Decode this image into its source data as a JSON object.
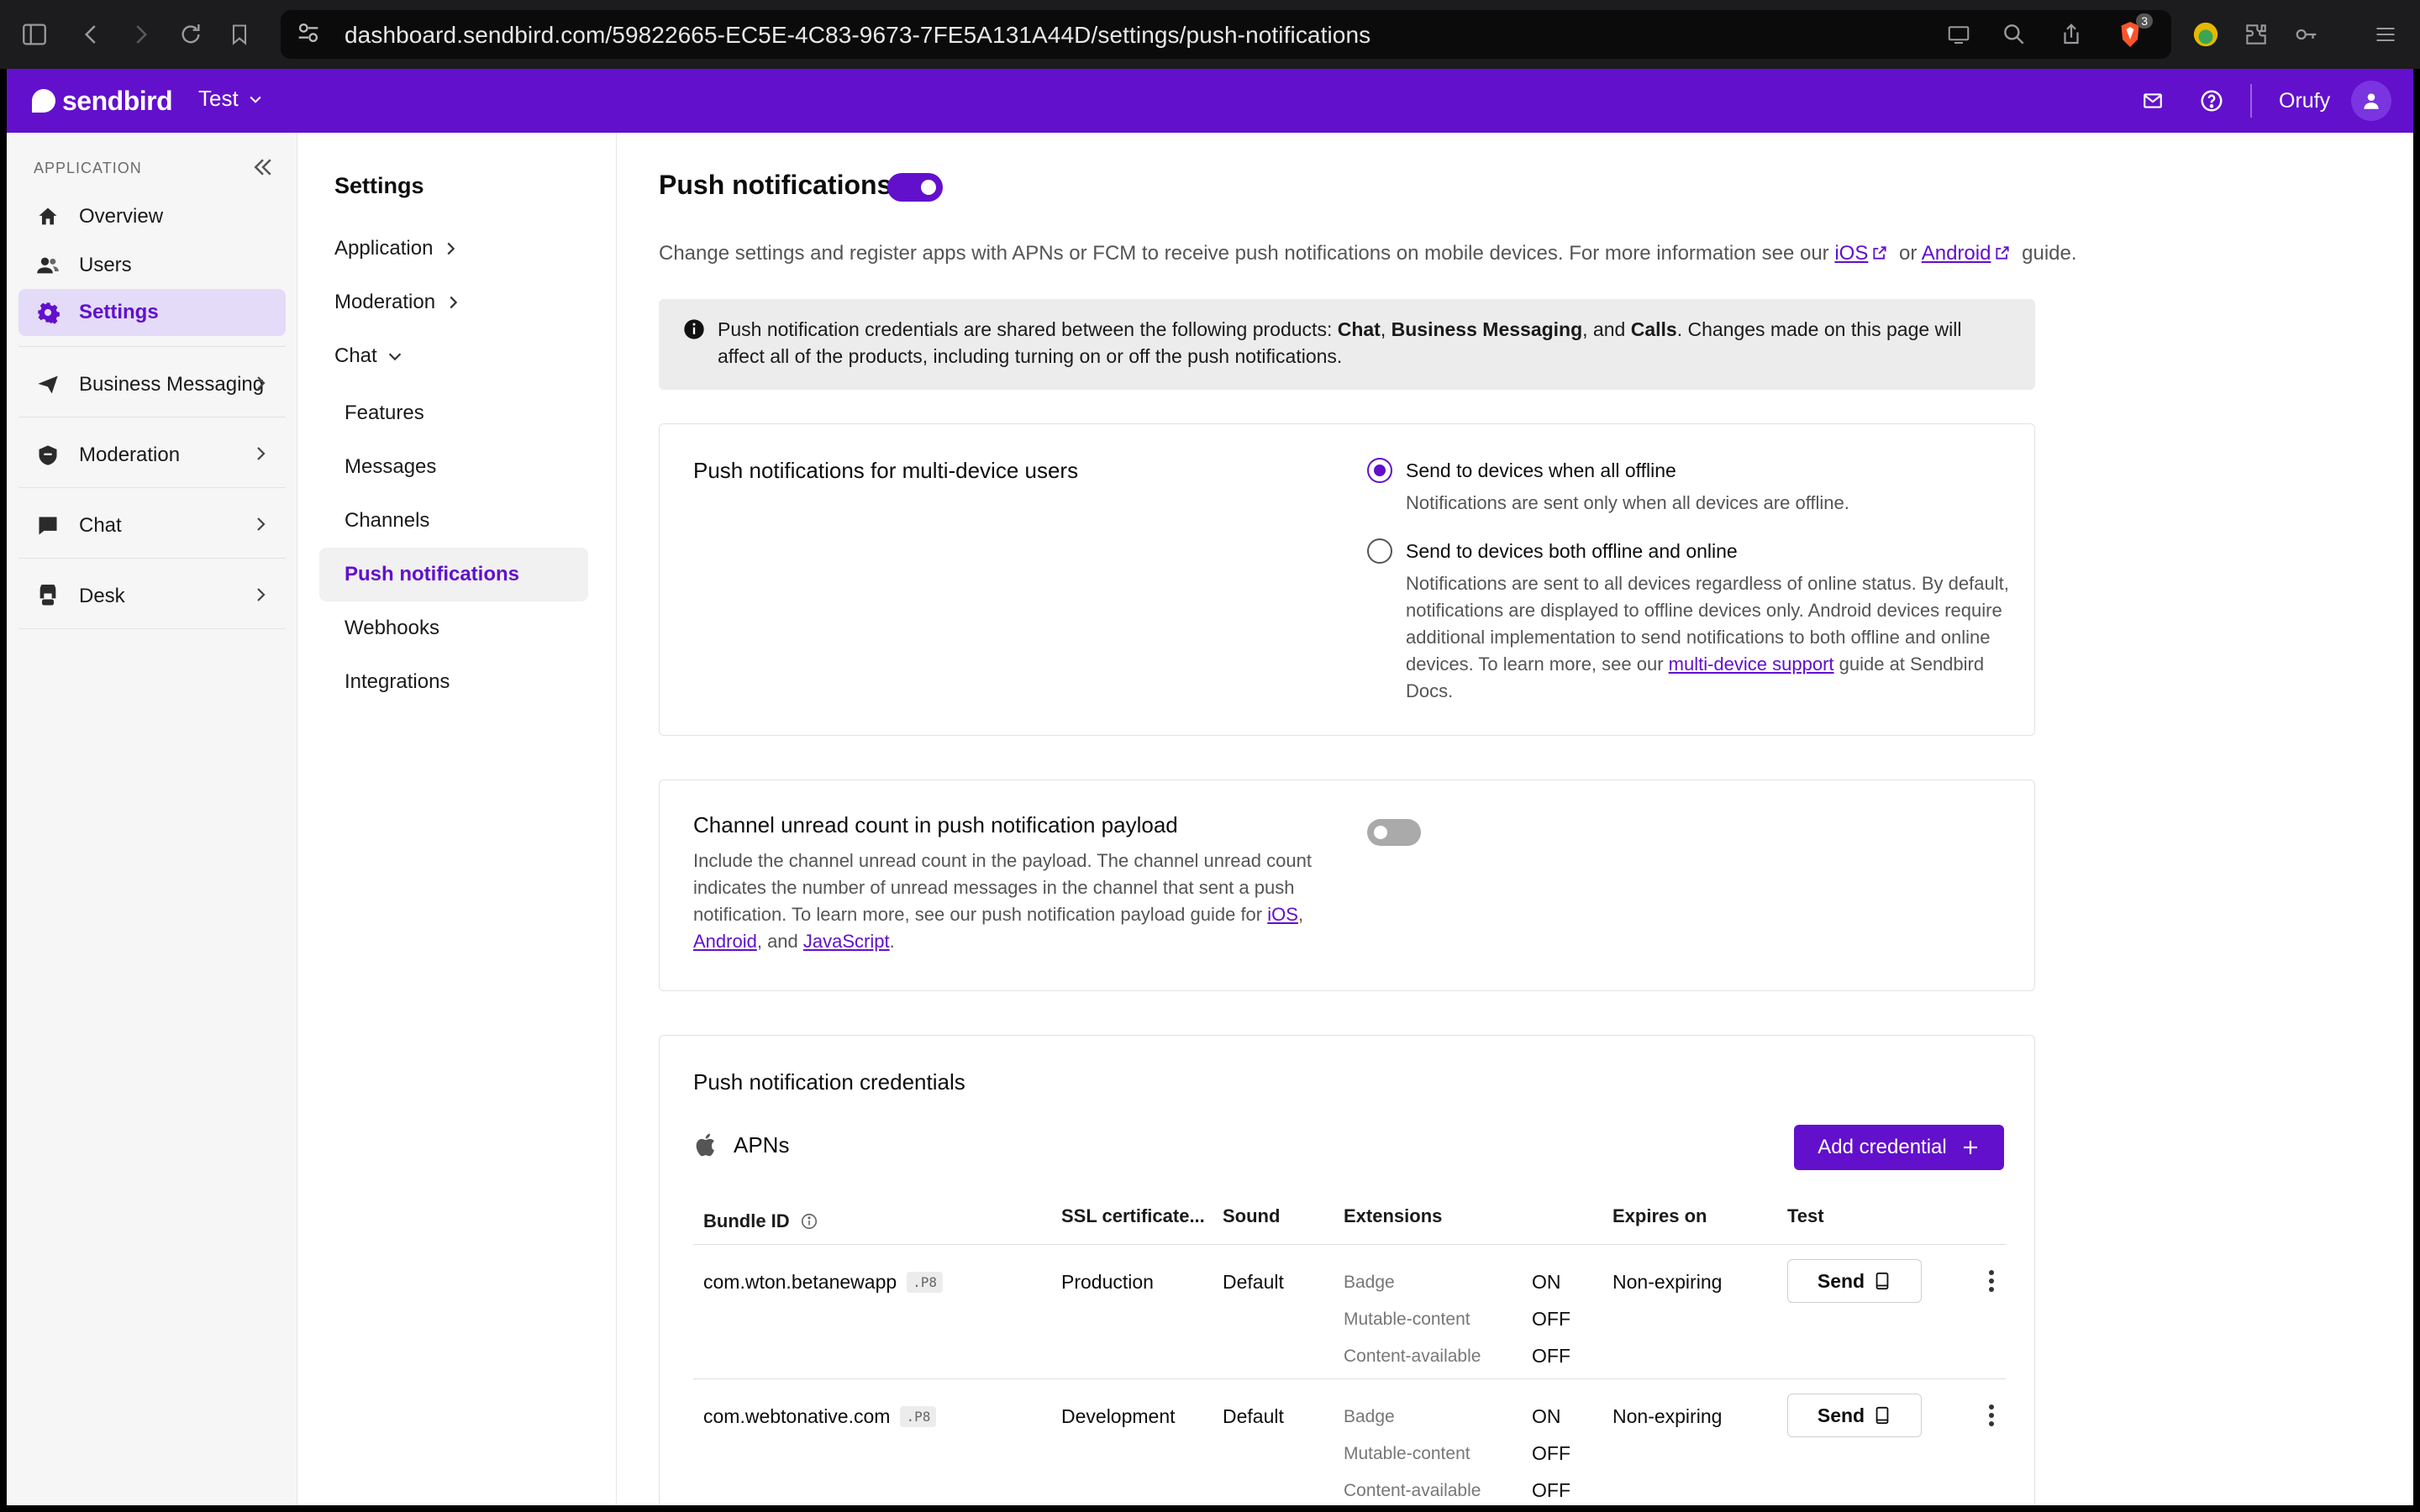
{
  "browser": {
    "url": "dashboard.sendbird.com/59822665-EC5E-4C83-9673-7FE5A131A44D/settings/push-notifications",
    "extension_badge": "3"
  },
  "topbar": {
    "logo_text": "sendbird",
    "app_name": "Test",
    "user_name": "Orufy"
  },
  "sidebar": {
    "section_label": "APPLICATION",
    "items": [
      {
        "label": "Overview",
        "icon": "home-icon"
      },
      {
        "label": "Users",
        "icon": "users-icon"
      },
      {
        "label": "Settings",
        "icon": "gear-icon"
      },
      {
        "label": "Business Messaging",
        "icon": "send-icon"
      },
      {
        "label": "Moderation",
        "icon": "moderation-icon"
      },
      {
        "label": "Chat",
        "icon": "chat-icon"
      },
      {
        "label": "Desk",
        "icon": "desk-icon"
      }
    ]
  },
  "settings_nav": {
    "title": "Settings",
    "groups": [
      "Application",
      "Moderation",
      "Chat"
    ],
    "chat_items": [
      "Features",
      "Messages",
      "Channels",
      "Push notifications",
      "Webhooks",
      "Integrations"
    ]
  },
  "main": {
    "title": "Push notifications",
    "description": {
      "before": "Change settings and register apps with APNs or FCM to receive push notifications on mobile devices. For more information see our ",
      "ios": "iOS",
      "or": " or ",
      "android": "Android",
      "after": " guide."
    },
    "alert": {
      "t1": "Push notification credentials are shared between the following products: ",
      "p1": "Chat",
      "t2": ", ",
      "p2": "Business Messaging",
      "t3": ", and ",
      "p3": "Calls",
      "t4": ". Changes made on this page will affect all of the products, including turning on or off the push notifications."
    },
    "multi_device": {
      "title": "Push notifications for multi-device users",
      "opt1_label": "Send to devices when all offline",
      "opt1_desc": "Notifications are sent only when all devices are offline.",
      "opt2_label": "Send to devices both offline and online",
      "opt2_desc": "Notifications are sent to all devices regardless of online status. By default, notifications are displayed to offline devices only. Android devices require additional implementation to send notifications to both offline and online devices. To learn more, see our ",
      "opt2_link": "multi-device support",
      "opt2_after": " guide at Sendbird Docs."
    },
    "unread": {
      "title": "Channel unread count in push notification payload",
      "desc": "Include the channel unread count in the payload. The channel unread count indicates the number of unread messages in the channel that sent a push notification. To learn more, see our push notification payload guide for ",
      "ios": "iOS",
      "comma": ", ",
      "android": "Android",
      "and": ", and ",
      "js": "JavaScript",
      "period": "."
    },
    "credentials": {
      "title": "Push notification credentials",
      "provider": "APNs",
      "add_label": "Add credential",
      "headers": [
        "Bundle ID",
        "SSL certificate...",
        "Sound",
        "Extensions",
        "Expires on",
        "Test"
      ],
      "rows": [
        {
          "bundle": "com.wton.betanewapp",
          "type": ".P8",
          "ssl": "Production",
          "sound": "Default",
          "ext": [
            {
              "name": "Badge",
              "val": "ON"
            },
            {
              "name": "Mutable-content",
              "val": "OFF"
            },
            {
              "name": "Content-available",
              "val": "OFF"
            }
          ],
          "expires": "Non-expiring",
          "send": "Send"
        },
        {
          "bundle": "com.webtonative.com",
          "type": ".P8",
          "ssl": "Development",
          "sound": "Default",
          "ext": [
            {
              "name": "Badge",
              "val": "ON"
            },
            {
              "name": "Mutable-content",
              "val": "OFF"
            },
            {
              "name": "Content-available",
              "val": "OFF"
            }
          ],
          "expires": "Non-expiring",
          "send": "Send"
        }
      ]
    }
  },
  "colors": {
    "brand": "#6210cc",
    "active_bg": "#e3dbf8"
  }
}
